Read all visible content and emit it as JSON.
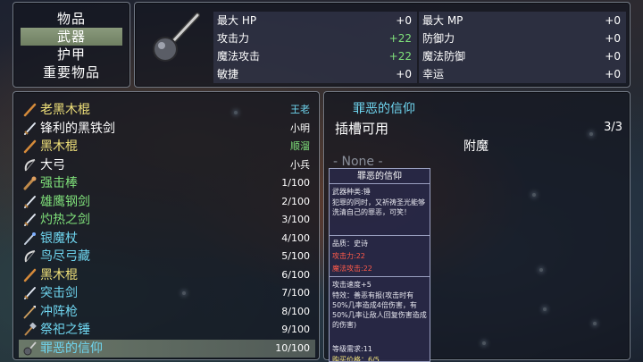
{
  "categories": [
    {
      "label": "物品",
      "selected": false
    },
    {
      "label": "武器",
      "selected": true
    },
    {
      "label": "护甲",
      "selected": false
    },
    {
      "label": "重要物品",
      "selected": false
    }
  ],
  "stats": {
    "weapon_icon": "mace-icon",
    "rows": [
      {
        "label": "最大 HP",
        "value": "+0",
        "up": false
      },
      {
        "label": "最大 MP",
        "value": "+0",
        "up": false
      },
      {
        "label": "攻击力",
        "value": "+22",
        "up": true
      },
      {
        "label": "防御力",
        "value": "+0",
        "up": false
      },
      {
        "label": "魔法攻击",
        "value": "+22",
        "up": true
      },
      {
        "label": "魔法防御",
        "value": "+0",
        "up": false
      },
      {
        "label": "敏捷",
        "value": "+0",
        "up": false
      },
      {
        "label": "幸运",
        "value": "+0",
        "up": false
      }
    ]
  },
  "weapons": [
    {
      "name": "老黑木棍",
      "count": "王老",
      "name_color": "yellow",
      "count_color": "cyan",
      "icon": "staff-icon"
    },
    {
      "name": "锋利的黑铁剑",
      "count": "小明",
      "name_color": "white",
      "count_color": "white",
      "icon": "sword-icon"
    },
    {
      "name": "黑木棍",
      "count": "顺溜",
      "name_color": "yellow",
      "count_color": "green",
      "icon": "staff-icon"
    },
    {
      "name": "大弓",
      "count": "小兵",
      "name_color": "white",
      "count_color": "white",
      "icon": "bow-icon"
    },
    {
      "name": "强击棒",
      "count": "1/100",
      "name_color": "green",
      "count_color": "white",
      "icon": "club-icon"
    },
    {
      "name": "雄鹰钢剑",
      "count": "2/100",
      "name_color": "green",
      "count_color": "white",
      "icon": "sword-icon"
    },
    {
      "name": "灼热之剑",
      "count": "3/100",
      "name_color": "green",
      "count_color": "white",
      "icon": "sword-icon"
    },
    {
      "name": "银魔杖",
      "count": "4/100",
      "name_color": "cyan",
      "count_color": "white",
      "icon": "wand-icon"
    },
    {
      "name": "鸟尽弓藏",
      "count": "5/100",
      "name_color": "cyan",
      "count_color": "white",
      "icon": "bow-icon"
    },
    {
      "name": "黑木棍",
      "count": "6/100",
      "name_color": "yellow",
      "count_color": "white",
      "icon": "staff-icon"
    },
    {
      "name": "突击剑",
      "count": "7/100",
      "name_color": "cyan",
      "count_color": "white",
      "icon": "sword-icon"
    },
    {
      "name": "冲阵枪",
      "count": "8/100",
      "name_color": "cyan",
      "count_color": "white",
      "icon": "spear-icon"
    },
    {
      "name": "祭祀之锤",
      "count": "9/100",
      "name_color": "cyan",
      "count_color": "white",
      "icon": "hammer-icon"
    },
    {
      "name": "罪恶的信仰",
      "count": "10/100",
      "name_color": "cyan",
      "count_color": "white",
      "icon": "mace-icon",
      "selected": true
    }
  ],
  "detail": {
    "title": "罪恶的信仰",
    "slots_label": "插槽可用",
    "slots_count": "3/3",
    "enchant_label": "附魔",
    "none_slot": "- None -"
  },
  "tooltip": {
    "title": "罪恶的信仰",
    "type": "武器种类:锤",
    "desc": "犯罪的同时，又祈祷圣光能够洗清自己的罪恶，可笑！",
    "quality": "品质：史诗",
    "atk": "攻击力:22",
    "matk": "魔法攻击:22",
    "speed": "攻击速度+5",
    "effect": "特效：善恶有报(攻击时有50%几率造成4倍伤害，有50%几率让敌人回复伤害造成的伤害)",
    "level": "等级需求:11",
    "price": "购买价格：6/5"
  },
  "colors": {
    "yellow": "#f1e27a",
    "white": "#ffffff",
    "cyan": "#6fd6f0",
    "green": "#7fe07a",
    "blue": "#6aa8ff",
    "panel_border": "#bec8d7"
  }
}
